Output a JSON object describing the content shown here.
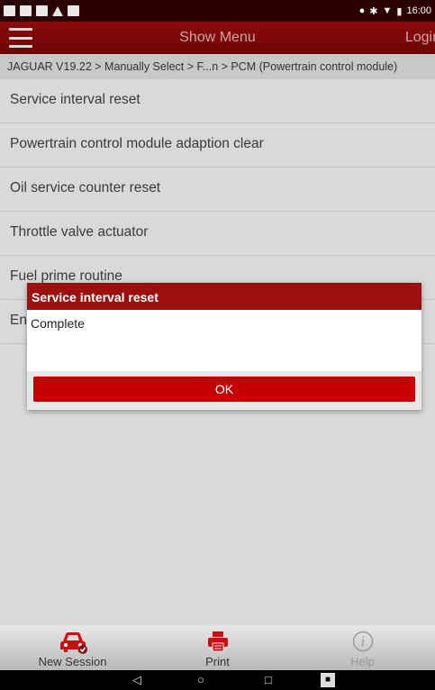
{
  "status_bar": {
    "time": "16:00"
  },
  "app_bar": {
    "menu_icon": "hamburger-icon",
    "title": "Show Menu",
    "login_label": "Login"
  },
  "breadcrumb": "JAGUAR V19.22 > Manually Select > F...n > PCM (Powertrain control module)",
  "menu": {
    "items": [
      {
        "label": "Service interval reset"
      },
      {
        "label": "Powertrain control module adaption clear"
      },
      {
        "label": "Oil service counter reset"
      },
      {
        "label": "Throttle valve actuator"
      },
      {
        "label": "Fuel prime routine"
      },
      {
        "label": "En"
      }
    ]
  },
  "dialog": {
    "title": "Service interval reset",
    "message": "Complete",
    "ok_label": "OK"
  },
  "toolbar": {
    "new_session_label": "New Session",
    "print_label": "Print",
    "help_label": "Help"
  },
  "colors": {
    "accent": "#c60000",
    "title_bar": "#9e1010",
    "status_bar": "#2a0000"
  }
}
